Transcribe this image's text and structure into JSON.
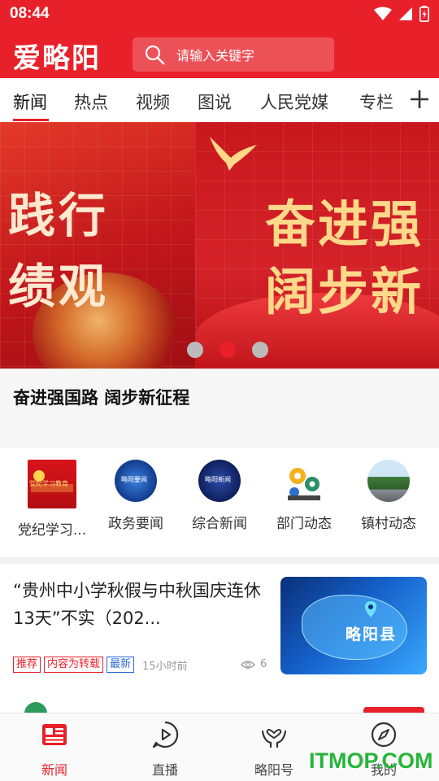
{
  "status_bar": {
    "time": "08:44"
  },
  "header": {
    "app_title": "爱略阳",
    "search": {
      "placeholder": "请输入关键字"
    }
  },
  "tabs": [
    {
      "label": "新闻",
      "active": true
    },
    {
      "label": "热点"
    },
    {
      "label": "视频"
    },
    {
      "label": "图说"
    },
    {
      "label": "人民党媒"
    },
    {
      "label": "专栏"
    }
  ],
  "banner": {
    "left_slide_text": [
      "践行",
      "绩观"
    ],
    "right_slide_text": [
      "奋进强",
      "阔步新"
    ],
    "caption": "奋进强国路 阔步新征程",
    "page_count": 3,
    "active_page": 2
  },
  "categories": [
    {
      "label": "党纪学习...",
      "icon_text": "党纪学习教育"
    },
    {
      "label": "政务要闻",
      "icon_text": "略阳要闻"
    },
    {
      "label": "综合新闻",
      "icon_text": "略阳新闻"
    },
    {
      "label": "部门动态"
    },
    {
      "label": "镇村动态"
    }
  ],
  "news": [
    {
      "title": "“贵州中小学秋假与中秋国庆连休13天”不实（202...",
      "tags": [
        "推荐",
        "内容为转载",
        "最新"
      ],
      "age": "15小时前",
      "views": "6",
      "thumb_text": "略阳县"
    }
  ],
  "bottom_nav": [
    {
      "label": "新闻",
      "active": true
    },
    {
      "label": "直播"
    },
    {
      "label": "略阳号"
    },
    {
      "label": "我的"
    }
  ],
  "watermark": "ITMOP.COM",
  "colors": {
    "brand_red": "#e8202a",
    "tag_blue": "#2b6ad8",
    "watermark_green": "#27b43a"
  }
}
